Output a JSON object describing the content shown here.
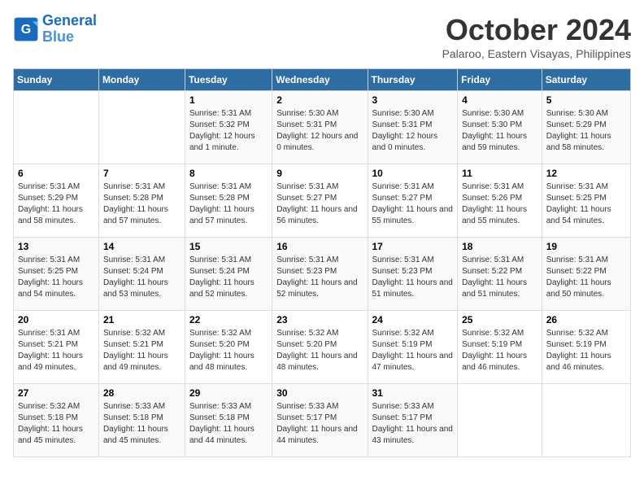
{
  "header": {
    "logo_line1": "General",
    "logo_line2": "Blue",
    "month_title": "October 2024",
    "subtitle": "Palaroo, Eastern Visayas, Philippines"
  },
  "weekdays": [
    "Sunday",
    "Monday",
    "Tuesday",
    "Wednesday",
    "Thursday",
    "Friday",
    "Saturday"
  ],
  "weeks": [
    [
      {
        "day": "",
        "sunrise": "",
        "sunset": "",
        "daylight": ""
      },
      {
        "day": "",
        "sunrise": "",
        "sunset": "",
        "daylight": ""
      },
      {
        "day": "1",
        "sunrise": "Sunrise: 5:31 AM",
        "sunset": "Sunset: 5:32 PM",
        "daylight": "Daylight: 12 hours and 1 minute."
      },
      {
        "day": "2",
        "sunrise": "Sunrise: 5:30 AM",
        "sunset": "Sunset: 5:31 PM",
        "daylight": "Daylight: 12 hours and 0 minutes."
      },
      {
        "day": "3",
        "sunrise": "Sunrise: 5:30 AM",
        "sunset": "Sunset: 5:31 PM",
        "daylight": "Daylight: 12 hours and 0 minutes."
      },
      {
        "day": "4",
        "sunrise": "Sunrise: 5:30 AM",
        "sunset": "Sunset: 5:30 PM",
        "daylight": "Daylight: 11 hours and 59 minutes."
      },
      {
        "day": "5",
        "sunrise": "Sunrise: 5:30 AM",
        "sunset": "Sunset: 5:29 PM",
        "daylight": "Daylight: 11 hours and 58 minutes."
      }
    ],
    [
      {
        "day": "6",
        "sunrise": "Sunrise: 5:31 AM",
        "sunset": "Sunset: 5:29 PM",
        "daylight": "Daylight: 11 hours and 58 minutes."
      },
      {
        "day": "7",
        "sunrise": "Sunrise: 5:31 AM",
        "sunset": "Sunset: 5:28 PM",
        "daylight": "Daylight: 11 hours and 57 minutes."
      },
      {
        "day": "8",
        "sunrise": "Sunrise: 5:31 AM",
        "sunset": "Sunset: 5:28 PM",
        "daylight": "Daylight: 11 hours and 57 minutes."
      },
      {
        "day": "9",
        "sunrise": "Sunrise: 5:31 AM",
        "sunset": "Sunset: 5:27 PM",
        "daylight": "Daylight: 11 hours and 56 minutes."
      },
      {
        "day": "10",
        "sunrise": "Sunrise: 5:31 AM",
        "sunset": "Sunset: 5:27 PM",
        "daylight": "Daylight: 11 hours and 55 minutes."
      },
      {
        "day": "11",
        "sunrise": "Sunrise: 5:31 AM",
        "sunset": "Sunset: 5:26 PM",
        "daylight": "Daylight: 11 hours and 55 minutes."
      },
      {
        "day": "12",
        "sunrise": "Sunrise: 5:31 AM",
        "sunset": "Sunset: 5:25 PM",
        "daylight": "Daylight: 11 hours and 54 minutes."
      }
    ],
    [
      {
        "day": "13",
        "sunrise": "Sunrise: 5:31 AM",
        "sunset": "Sunset: 5:25 PM",
        "daylight": "Daylight: 11 hours and 54 minutes."
      },
      {
        "day": "14",
        "sunrise": "Sunrise: 5:31 AM",
        "sunset": "Sunset: 5:24 PM",
        "daylight": "Daylight: 11 hours and 53 minutes."
      },
      {
        "day": "15",
        "sunrise": "Sunrise: 5:31 AM",
        "sunset": "Sunset: 5:24 PM",
        "daylight": "Daylight: 11 hours and 52 minutes."
      },
      {
        "day": "16",
        "sunrise": "Sunrise: 5:31 AM",
        "sunset": "Sunset: 5:23 PM",
        "daylight": "Daylight: 11 hours and 52 minutes."
      },
      {
        "day": "17",
        "sunrise": "Sunrise: 5:31 AM",
        "sunset": "Sunset: 5:23 PM",
        "daylight": "Daylight: 11 hours and 51 minutes."
      },
      {
        "day": "18",
        "sunrise": "Sunrise: 5:31 AM",
        "sunset": "Sunset: 5:22 PM",
        "daylight": "Daylight: 11 hours and 51 minutes."
      },
      {
        "day": "19",
        "sunrise": "Sunrise: 5:31 AM",
        "sunset": "Sunset: 5:22 PM",
        "daylight": "Daylight: 11 hours and 50 minutes."
      }
    ],
    [
      {
        "day": "20",
        "sunrise": "Sunrise: 5:31 AM",
        "sunset": "Sunset: 5:21 PM",
        "daylight": "Daylight: 11 hours and 49 minutes."
      },
      {
        "day": "21",
        "sunrise": "Sunrise: 5:32 AM",
        "sunset": "Sunset: 5:21 PM",
        "daylight": "Daylight: 11 hours and 49 minutes."
      },
      {
        "day": "22",
        "sunrise": "Sunrise: 5:32 AM",
        "sunset": "Sunset: 5:20 PM",
        "daylight": "Daylight: 11 hours and 48 minutes."
      },
      {
        "day": "23",
        "sunrise": "Sunrise: 5:32 AM",
        "sunset": "Sunset: 5:20 PM",
        "daylight": "Daylight: 11 hours and 48 minutes."
      },
      {
        "day": "24",
        "sunrise": "Sunrise: 5:32 AM",
        "sunset": "Sunset: 5:19 PM",
        "daylight": "Daylight: 11 hours and 47 minutes."
      },
      {
        "day": "25",
        "sunrise": "Sunrise: 5:32 AM",
        "sunset": "Sunset: 5:19 PM",
        "daylight": "Daylight: 11 hours and 46 minutes."
      },
      {
        "day": "26",
        "sunrise": "Sunrise: 5:32 AM",
        "sunset": "Sunset: 5:19 PM",
        "daylight": "Daylight: 11 hours and 46 minutes."
      }
    ],
    [
      {
        "day": "27",
        "sunrise": "Sunrise: 5:32 AM",
        "sunset": "Sunset: 5:18 PM",
        "daylight": "Daylight: 11 hours and 45 minutes."
      },
      {
        "day": "28",
        "sunrise": "Sunrise: 5:33 AM",
        "sunset": "Sunset: 5:18 PM",
        "daylight": "Daylight: 11 hours and 45 minutes."
      },
      {
        "day": "29",
        "sunrise": "Sunrise: 5:33 AM",
        "sunset": "Sunset: 5:18 PM",
        "daylight": "Daylight: 11 hours and 44 minutes."
      },
      {
        "day": "30",
        "sunrise": "Sunrise: 5:33 AM",
        "sunset": "Sunset: 5:17 PM",
        "daylight": "Daylight: 11 hours and 44 minutes."
      },
      {
        "day": "31",
        "sunrise": "Sunrise: 5:33 AM",
        "sunset": "Sunset: 5:17 PM",
        "daylight": "Daylight: 11 hours and 43 minutes."
      },
      {
        "day": "",
        "sunrise": "",
        "sunset": "",
        "daylight": ""
      },
      {
        "day": "",
        "sunrise": "",
        "sunset": "",
        "daylight": ""
      }
    ]
  ]
}
